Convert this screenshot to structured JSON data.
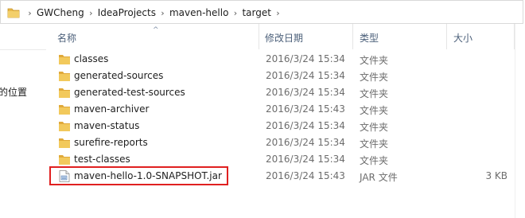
{
  "address_bar": {
    "crumbs": [
      "GWCheng",
      "IdeaProjects",
      "maven-hello",
      "target"
    ],
    "separator": "›"
  },
  "left_pane": {
    "location_label": "的位置"
  },
  "header": {
    "name": "名称",
    "date_modified": "修改日期",
    "type": "类型",
    "size": "大小",
    "sort_indicator": "^"
  },
  "files": [
    {
      "name": "classes",
      "date": "2016/3/24 15:34",
      "type": "文件夹",
      "size": "",
      "icon": "folder-icon"
    },
    {
      "name": "generated-sources",
      "date": "2016/3/24 15:34",
      "type": "文件夹",
      "size": "",
      "icon": "folder-icon"
    },
    {
      "name": "generated-test-sources",
      "date": "2016/3/24 15:34",
      "type": "文件夹",
      "size": "",
      "icon": "folder-icon"
    },
    {
      "name": "maven-archiver",
      "date": "2016/3/24 15:43",
      "type": "文件夹",
      "size": "",
      "icon": "folder-icon"
    },
    {
      "name": "maven-status",
      "date": "2016/3/24 15:34",
      "type": "文件夹",
      "size": "",
      "icon": "folder-icon"
    },
    {
      "name": "surefire-reports",
      "date": "2016/3/24 15:34",
      "type": "文件夹",
      "size": "",
      "icon": "folder-icon"
    },
    {
      "name": "test-classes",
      "date": "2016/3/24 15:34",
      "type": "文件夹",
      "size": "",
      "icon": "folder-icon"
    },
    {
      "name": "maven-hello-1.0-SNAPSHOT.jar",
      "date": "2016/3/24 15:43",
      "type": "JAR 文件",
      "size": "3 KB",
      "icon": "jar-file-icon"
    }
  ],
  "colors": {
    "folder": "#e8b94a",
    "highlight_border": "#e02020",
    "header_text": "#4c607a"
  }
}
